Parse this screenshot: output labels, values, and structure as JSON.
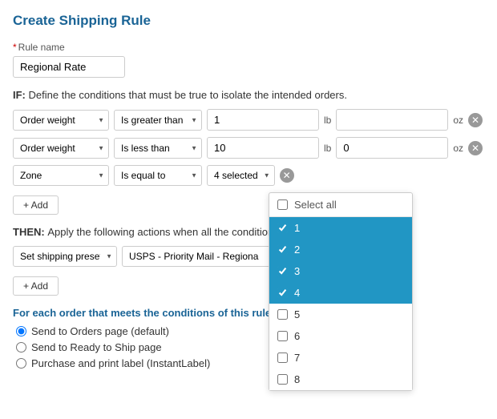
{
  "page": {
    "title": "Create Shipping Rule"
  },
  "rule_name": {
    "label": "Rule name",
    "value": "Regional Rate",
    "placeholder": ""
  },
  "if_section": {
    "prefix": "IF:",
    "description": "Define the conditions that must be true to isolate the intended orders."
  },
  "conditions": [
    {
      "id": "cond1",
      "field": "Order weight",
      "operator": "Is greater than",
      "value_lb": "1",
      "unit_lb": "lb",
      "value_oz": "",
      "unit_oz": "oz",
      "has_remove": true
    },
    {
      "id": "cond2",
      "field": "Order weight",
      "operator": "Is less than",
      "value_lb": "10",
      "unit_lb": "lb",
      "value_oz": "0",
      "unit_oz": "oz",
      "has_remove": true
    }
  ],
  "zone_condition": {
    "field": "Zone",
    "operator": "Is equal to",
    "selected_label": "4 selected",
    "has_remove": false
  },
  "add_condition_btn": "+ Add",
  "then_section": {
    "prefix": "THEN:",
    "description": "Apply the following actions when all the conditions abov"
  },
  "actions": [
    {
      "action_type": "Set shipping preset",
      "action_value": "USPS - Priority Mail - Regiona"
    }
  ],
  "add_action_btn": "+ Add",
  "for_each_section": {
    "label": "For each order that meets the conditions of this rule:",
    "options": [
      {
        "id": "opt1",
        "label": "Send to Orders page (default)",
        "checked": true
      },
      {
        "id": "opt2",
        "label": "Send to Ready to Ship page",
        "checked": false
      },
      {
        "id": "opt3",
        "label": "Purchase and print label (InstantLabel)",
        "checked": false
      }
    ]
  },
  "dropdown": {
    "select_all_label": "Select all",
    "items": [
      {
        "value": "1",
        "checked": true
      },
      {
        "value": "2",
        "checked": true
      },
      {
        "value": "3",
        "checked": true
      },
      {
        "value": "4",
        "checked": true
      },
      {
        "value": "5",
        "checked": false
      },
      {
        "value": "6",
        "checked": false
      },
      {
        "value": "7",
        "checked": false
      },
      {
        "value": "8",
        "checked": false
      }
    ]
  },
  "colors": {
    "title": "#1a6496",
    "for_each_label": "#1a6496",
    "checked_bg": "#2196c4"
  }
}
